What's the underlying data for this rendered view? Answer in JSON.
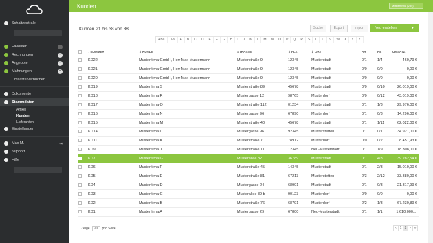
{
  "sidebar": {
    "schaltzentrale": "Schaltzentrale",
    "favoriten": "Favoriten",
    "rechnungen": "Rechnungen",
    "angebote": "Angebote",
    "mahnungen": "Mahnungen",
    "umsaetze": "Umsätze verbuchen",
    "dokumente": "Dokumente",
    "stammdaten": "Stammdaten",
    "artikel": "Artikel",
    "kunden": "Kunden",
    "lieferanten": "Lieferanten",
    "einstellungen": "Einstellungen",
    "user": "Max M.",
    "support": "Support",
    "hilfe": "Hilfe"
  },
  "topbar": {
    "title": "Kunden",
    "company_select": "Musterfirma (234)"
  },
  "toolbar": {
    "summary": "Kunden 21 bis 38 von 38",
    "suche": "Suche",
    "export": "Export",
    "import": "Import",
    "neu": "Neu erstellen"
  },
  "alphabet": [
    "ABC",
    "0-9",
    "A",
    "B",
    "C",
    "D",
    "E",
    "F",
    "G",
    "H",
    "I",
    "J",
    "K",
    "L",
    "M",
    "N",
    "O",
    "P",
    "Q",
    "R",
    "S",
    "T",
    "U",
    "V",
    "W",
    "X",
    "Y",
    "Z"
  ],
  "columns": {
    "nummer": "NUMMER",
    "kunde": "KUNDE",
    "strasse": "STRASSE",
    "plz": "PLZ",
    "ort": "ORT",
    "ar": "AR",
    "re": "RE",
    "umsatz": "UMSATZ"
  },
  "rows": [
    [
      "KD22",
      "Musterfirma GmbH, Herr Max Mustermann",
      "Musterstraße 9",
      "12345",
      "Musterstadt",
      "0/1",
      "1/4",
      "460,79 €"
    ],
    [
      "KD21",
      "Musterfirma GmbH, Herr Max Mustermann",
      "Musterstraße 9",
      "12345",
      "Musterstadt",
      "0/0",
      "0/0",
      "0,00 €"
    ],
    [
      "KD20",
      "Musterfirma GmbH, Herr Max Mustermann",
      "Musterstraße 9",
      "12345",
      "Musterstadt",
      "0/0",
      "0/0",
      "0,00 €"
    ],
    [
      "KD19",
      "Musterfirma S",
      "Musterstraße 89",
      "45678",
      "Musterstadt",
      "0/0",
      "0/10",
      "26.019,00 €"
    ],
    [
      "KD18",
      "Musterfirma R",
      "Mustergasse 12",
      "98765",
      "Musterdorf",
      "0/0",
      "0/12",
      "43.019,00 €"
    ],
    [
      "KD17",
      "Musterfirma Q",
      "Musterstraße 112",
      "01234",
      "Musterstadt",
      "0/1",
      "1/3",
      "29.976,00 €"
    ],
    [
      "KD16",
      "Musterfirma N",
      "Mustergasse 96",
      "67890",
      "Musterdorf",
      "0/1",
      "0/3",
      "14.296,00 €"
    ],
    [
      "KD15",
      "Musterfirma M",
      "Musterstraße 40",
      "45678",
      "Musterstadt",
      "0/1",
      "1/11",
      "62.022,00 €"
    ],
    [
      "KD14",
      "Musterfirma L",
      "Mustergasse 96",
      "92345",
      "Musterstetten",
      "0/1",
      "0/1",
      "34.921,00 €"
    ],
    [
      "KD11",
      "Musterfirma K",
      "Musterstraße 7",
      "78912",
      "Musterdorf",
      "0/0",
      "0/2",
      "8.451,93 €"
    ],
    [
      "KD9",
      "Musterfirma J",
      "Musterstraße 11",
      "12345",
      "Neu-Musterstadt",
      "0/1",
      "1/9",
      "18.308,00 €"
    ],
    [
      "KD7",
      "Musterfirma G",
      "Musterallee 82",
      "36789",
      "Musterstadt",
      "0/1",
      "4/8",
      "39.282,54 €"
    ],
    [
      "KD6",
      "Musterfirma F",
      "Musterstraße 45",
      "14345",
      "Musterstadt",
      "0/1",
      "2/3",
      "15.010,00 €"
    ],
    [
      "KD5",
      "Musterfirma E",
      "Musterstraße 81",
      "67213",
      "Musterstetten",
      "2/3",
      "2/12",
      "33.380,00 €"
    ],
    [
      "KD4",
      "Musterfirma D",
      "Mustergasse 24",
      "68901",
      "Musterstadt",
      "0/1",
      "0/3",
      "21.317,99 €"
    ],
    [
      "KD3",
      "Musterfirma C",
      "Musterallee 39 b",
      "90123",
      "Musterdorf",
      "0/0",
      "0/0",
      "0,00 €"
    ],
    [
      "KD2",
      "Musterfirma B",
      "Musterstraße 76",
      "68791",
      "Musterdorf",
      "2/2",
      "1/3",
      "67.230,89 €"
    ],
    [
      "KD1",
      "Musterfirma A",
      "Mustergasse 29",
      "67800",
      "Neu-Musterstadt",
      "0/1",
      "1/1",
      "1.610.000,... "
    ]
  ],
  "selected_row": 11,
  "footer": {
    "zeige": "Zeige",
    "per_page": "20",
    "pro_seite": "pro Seite"
  },
  "pager": [
    "‹",
    "1",
    "2",
    "›",
    "»"
  ],
  "pager_current": 2,
  "colors": {
    "accent": "#8cc63f",
    "sidebar": "#2b2d2f"
  }
}
